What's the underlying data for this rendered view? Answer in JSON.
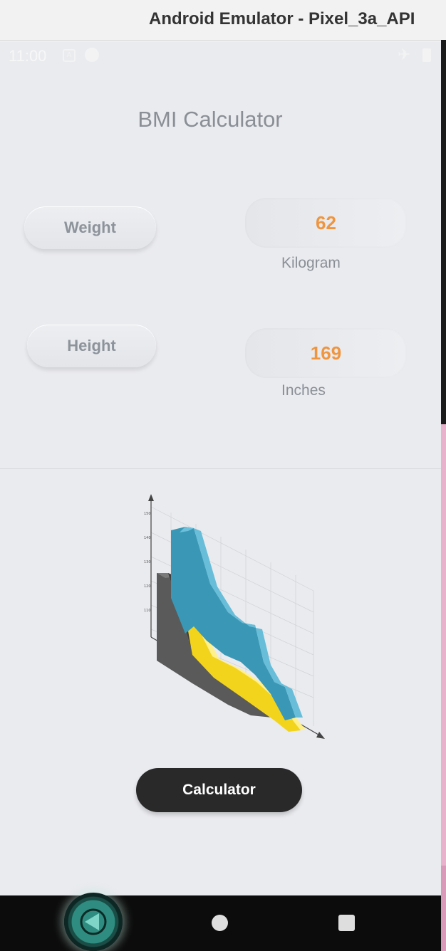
{
  "window": {
    "title": "Android Emulator - Pixel_3a_API"
  },
  "status_bar": {
    "time": "11:00",
    "icons": [
      "a-icon",
      "p-icon",
      "airplane-icon",
      "battery-icon"
    ]
  },
  "app": {
    "title": "BMI Calculator",
    "weight": {
      "button_label": "Weight",
      "value": "62",
      "unit": "Kilogram"
    },
    "height": {
      "button_label": "Height",
      "value": "169",
      "unit": "Inches"
    },
    "calculate_button": "Calculator"
  },
  "illustration": {
    "type": "3d-area-chart-graphic",
    "colors": [
      "#3a98b6",
      "#f3d41c",
      "#5a5a5a"
    ]
  },
  "nav_bar": {
    "icons": [
      "back-icon",
      "home-icon",
      "recents-icon"
    ]
  },
  "colors": {
    "accent_value": "#f0953f",
    "button_dark": "#292929",
    "screen_bg": "#eaebef"
  }
}
